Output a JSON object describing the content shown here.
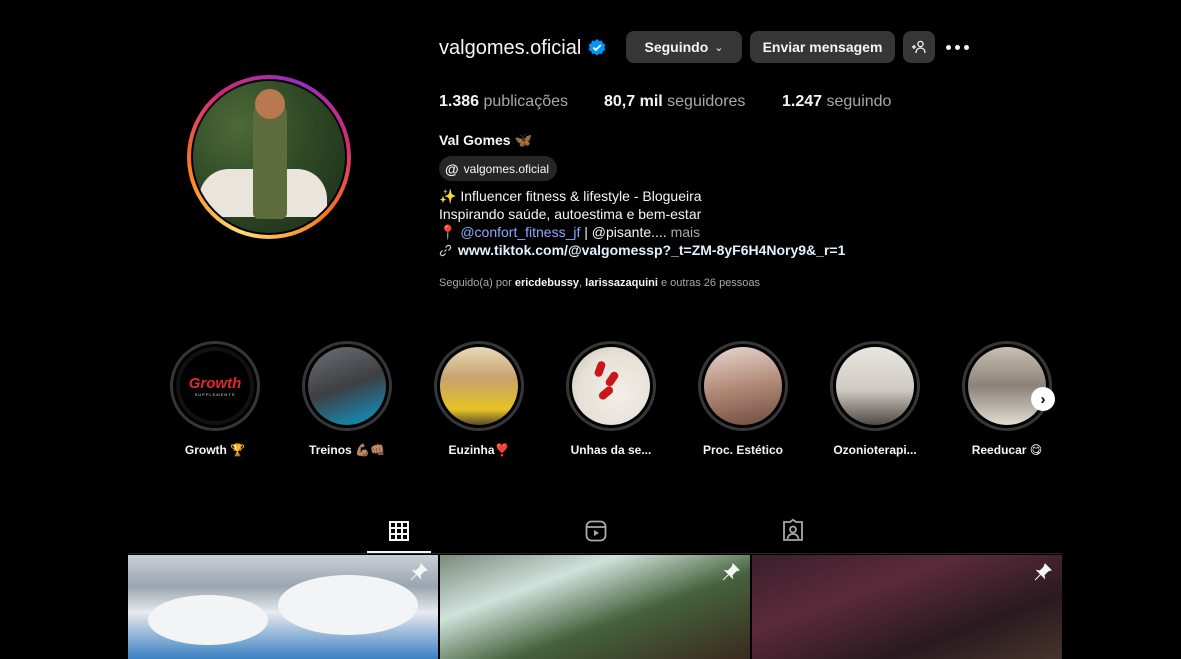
{
  "profile": {
    "username": "valgomes.oficial",
    "verified": true,
    "buttons": {
      "following": "Seguindo",
      "message": "Enviar mensagem"
    },
    "stats": {
      "posts_count": "1.386",
      "posts_label": "publicações",
      "followers_count": "80,7 mil",
      "followers_label": "seguidores",
      "following_count": "1.247",
      "following_label": "seguindo"
    },
    "full_name": "Val Gomes 🦋",
    "threads_handle": "valgomes.oficial",
    "bio": {
      "line1": "✨ Influencer fitness & lifestyle - Blogueira",
      "line2": "Inspirando saúde, autoestima e bem-estar",
      "line3_pin": "📍",
      "line3_mention": "@confort_fitness_jf",
      "line3_rest": " | @pisante....",
      "line3_more": "mais",
      "link": "www.tiktok.com/@valgomessp?_t=ZM-8yF6H4Nory9&_r=1"
    },
    "followed_by": {
      "prefix": "Seguido(a) por ",
      "user1": "ericdebussy",
      "separator": ", ",
      "user2": "larissazaquini",
      "suffix": " e outras 26 pessoas"
    }
  },
  "highlights": [
    {
      "label": "Growth 🏆"
    },
    {
      "label": "Treinos 💪🏽👊🏽"
    },
    {
      "label": "Euzinha❣️"
    },
    {
      "label": "Unhas da se..."
    },
    {
      "label": "Proc. Estético"
    },
    {
      "label": "Ozonioterapi..."
    },
    {
      "label": "Reeducar 😋"
    }
  ],
  "highlight_logo": {
    "word": "Growth",
    "sub": "SUPPLEMENTS"
  },
  "tabs": [
    "posts-grid-icon",
    "reels-icon",
    "tagged-icon"
  ],
  "colors": {
    "background": "#000000",
    "button": "#363636",
    "mention": "#8fa7ff",
    "verified": "#0095f6"
  }
}
